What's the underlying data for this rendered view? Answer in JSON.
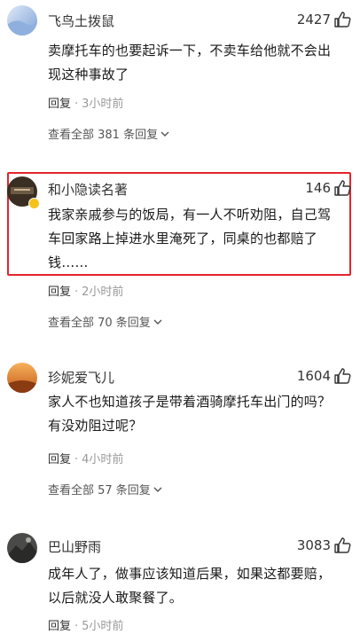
{
  "comments": [
    {
      "name": "飞鸟土拨鼠",
      "likes": "2427",
      "text_lines": [
        "卖摩托车的也要起诉一下，不卖车给他就不会出",
        "现这种事故了"
      ],
      "reply_label": "回复",
      "time": "3小时前",
      "view_replies": "查看全部 381 条回复",
      "avatar_icon": "blue-gradient-avatar"
    },
    {
      "name": "和小隐读名著",
      "likes": "146",
      "text_lines": [
        "我家亲戚参与的饭局，有一人不听劝阻，自己驾",
        "车回家路上掉进水里淹死了，同桌的也都赔了",
        "钱……"
      ],
      "reply_label": "回复",
      "time": "2小时前",
      "view_replies": "查看全部 70 条回复",
      "avatar_icon": "dark-photo-avatar"
    },
    {
      "name": "珍妮爱飞儿",
      "likes": "1604",
      "text_lines": [
        "家人不也知道孩子是带着酒骑摩托车出门的吗？",
        "有没劝阻过呢？"
      ],
      "reply_label": "回复",
      "time": "4小时前",
      "view_replies": "查看全部 57 条回复",
      "avatar_icon": "sunset-avatar"
    },
    {
      "name": "巴山野雨",
      "likes": "3083",
      "text_lines": [
        "成年人了，做事应该知道后果，如果这都要赔，",
        "以后就没人敢聚餐了。"
      ],
      "reply_label": "回复",
      "time": "5小时前",
      "avatar_icon": "mountain-avatar"
    }
  ],
  "colors": {
    "highlight_border": "#e5242b",
    "meta_gray": "#999999",
    "verified_badge": "#f4c21b"
  },
  "icons": {
    "like": "thumbs-up-icon",
    "expand": "chevron-down-icon"
  }
}
